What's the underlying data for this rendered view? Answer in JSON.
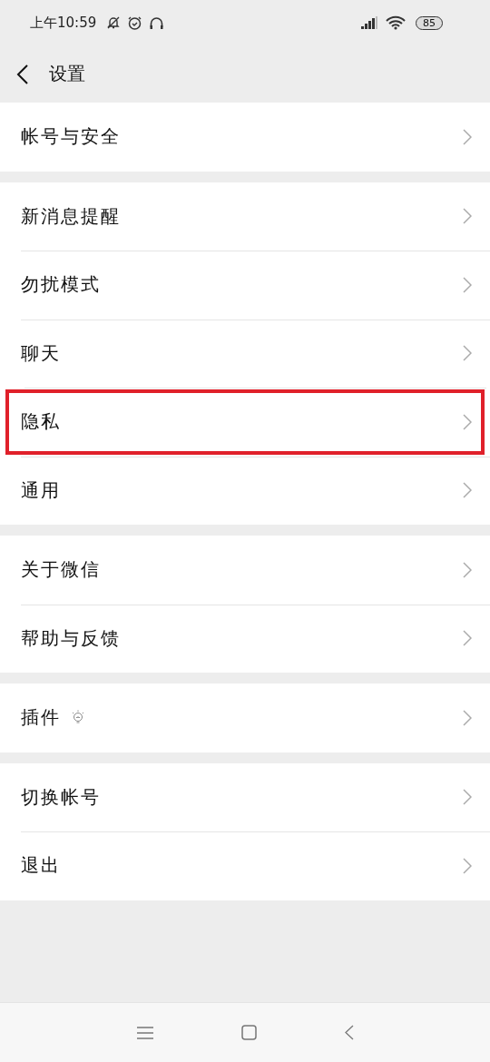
{
  "status_bar": {
    "time": "上午10:59",
    "battery": "85"
  },
  "header": {
    "title": "设置"
  },
  "groups": [
    {
      "items": [
        {
          "label": "帐号与安全",
          "kind": "plain",
          "highlighted": false
        }
      ]
    },
    {
      "items": [
        {
          "label": "新消息提醒",
          "kind": "plain",
          "highlighted": false
        },
        {
          "label": "勿扰模式",
          "kind": "plain",
          "highlighted": false
        },
        {
          "label": "聊天",
          "kind": "plain",
          "highlighted": false
        },
        {
          "label": "隐私",
          "kind": "plain",
          "highlighted": true
        },
        {
          "label": "通用",
          "kind": "plain",
          "highlighted": false
        }
      ]
    },
    {
      "items": [
        {
          "label": "关于微信",
          "kind": "plain",
          "highlighted": false
        },
        {
          "label": "帮助与反馈",
          "kind": "plain",
          "highlighted": false
        }
      ]
    },
    {
      "items": [
        {
          "label": "插件",
          "kind": "with_icon",
          "highlighted": false
        }
      ]
    },
    {
      "items": [
        {
          "label": "切换帐号",
          "kind": "plain",
          "highlighted": false
        },
        {
          "label": "退出",
          "kind": "plain",
          "highlighted": false
        }
      ]
    }
  ]
}
